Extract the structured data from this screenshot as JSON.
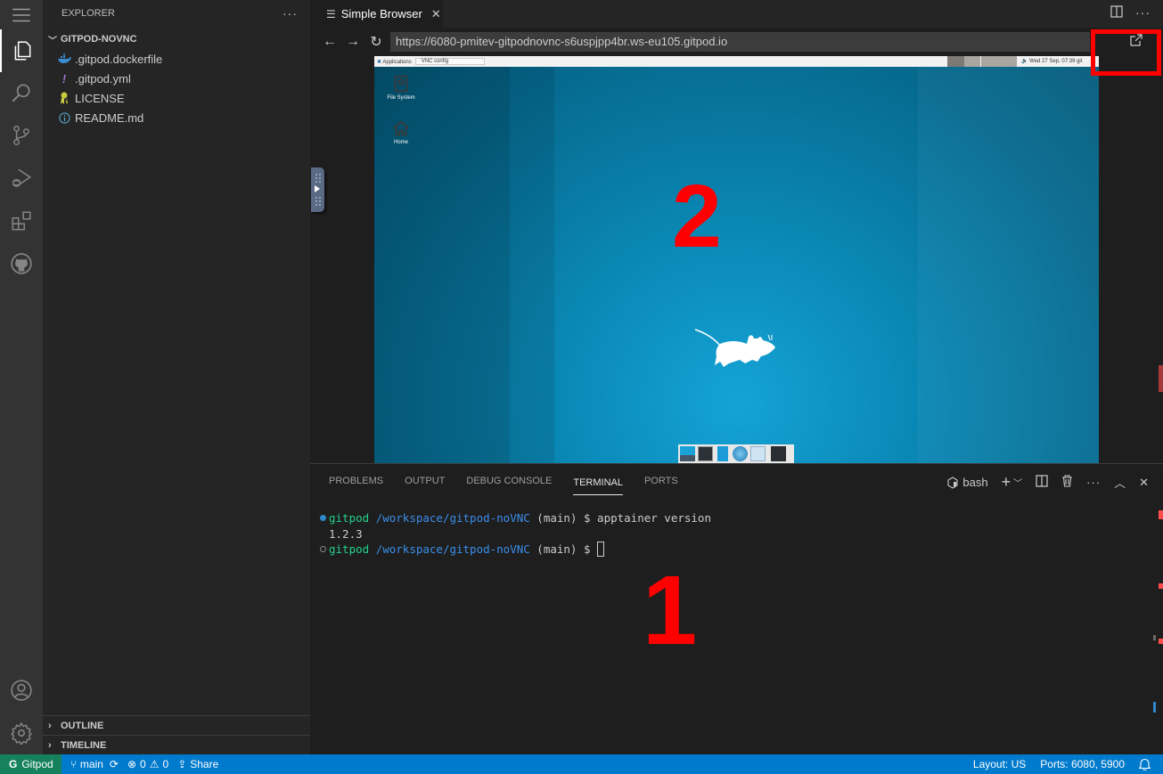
{
  "activity_bar": {
    "items": [
      {
        "name": "menu-icon"
      },
      {
        "name": "explorer-icon",
        "active": true
      },
      {
        "name": "search-icon"
      },
      {
        "name": "source-control-icon"
      },
      {
        "name": "run-debug-icon"
      },
      {
        "name": "extensions-icon"
      },
      {
        "name": "github-icon"
      }
    ],
    "bottom": [
      {
        "name": "account-icon"
      },
      {
        "name": "settings-gear-icon"
      }
    ]
  },
  "sidebar": {
    "title": "EXPLORER",
    "more": "···",
    "folder": "GITPOD-NOVNC",
    "files": [
      {
        "name": ".gitpod.dockerfile",
        "icon": "docker-icon"
      },
      {
        "name": ".gitpod.yml",
        "icon": "yaml-icon"
      },
      {
        "name": "LICENSE",
        "icon": "license-icon"
      },
      {
        "name": "README.md",
        "icon": "info-icon"
      }
    ],
    "sections": [
      "OUTLINE",
      "TIMELINE"
    ]
  },
  "editor": {
    "tab": {
      "label": "Simple Browser",
      "close": "✕"
    },
    "url": "https://6080-pmitev-gitpodnovnc-s6uspjpp4br.ws-eu105.gitpod.io"
  },
  "desktop": {
    "panel": {
      "apps": "Applications",
      "window": "VNC config",
      "clock": "Wed 27 Sep, 07:39",
      "user": "git"
    },
    "icons": [
      {
        "label": "File System"
      },
      {
        "label": "Home"
      }
    ],
    "annotation": "2"
  },
  "panel": {
    "tabs": [
      "PROBLEMS",
      "OUTPUT",
      "DEBUG CONSOLE",
      "TERMINAL",
      "PORTS"
    ],
    "active_tab": "TERMINAL",
    "shell": "bash",
    "terminal": {
      "lines": [
        {
          "user": "gitpod",
          "path": "/workspace/gitpod-noVNC",
          "rest": " (main) $ apptainer version",
          "decoration": "success"
        },
        {
          "output": "1.2.3"
        },
        {
          "user": "gitpod",
          "path": "/workspace/gitpod-noVNC",
          "rest": " (main) $ ",
          "decoration": "empty"
        }
      ]
    },
    "annotation": "1"
  },
  "colors": {
    "accent": "#007acc",
    "remote": "#16825d",
    "annotation": "#ff0000"
  },
  "statusbar": {
    "remote": "Gitpod",
    "branch": "main",
    "errors": "0",
    "warnings": "0",
    "share": "Share",
    "layout": "Layout: US",
    "ports": "Ports: 6080, 5900"
  }
}
